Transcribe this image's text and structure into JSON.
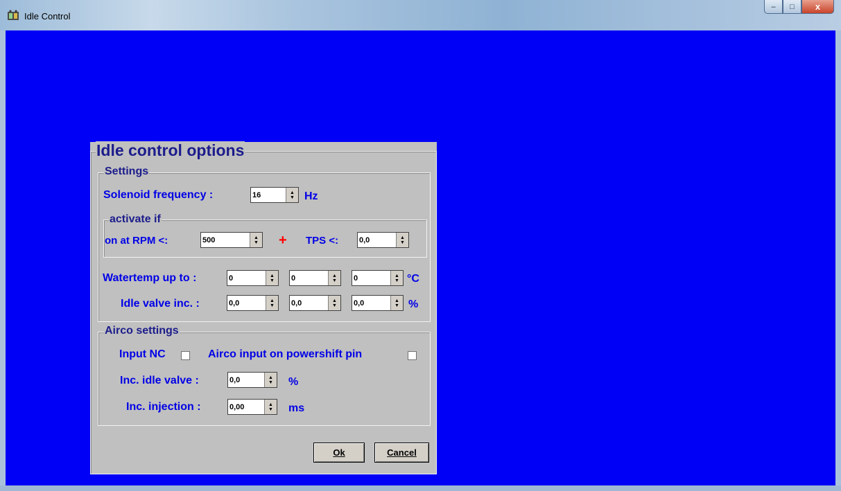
{
  "window": {
    "title": "Idle Control",
    "minimize": "–",
    "maximize": "□",
    "close": "x"
  },
  "dialog": {
    "title": "Idle control options",
    "settings": {
      "legend": "Settings",
      "solenoid_label": "Solenoid frequency :",
      "solenoid_value": "16",
      "solenoid_unit": "Hz",
      "activate": {
        "legend": "activate if",
        "rpm_label": "on at RPM  <:",
        "rpm_value": "500",
        "plus": "+",
        "tps_label": "TPS <:",
        "tps_value": "0,0"
      },
      "watertemp_label": "Watertemp up to :",
      "watertemp_values": [
        "0",
        "0",
        "0"
      ],
      "watertemp_unit": "°C",
      "idle_valve_label": "Idle valve inc. :",
      "idle_valve_values": [
        "0,0",
        "0,0",
        "0,0"
      ],
      "idle_valve_unit": "%"
    },
    "airco": {
      "legend": "Airco settings",
      "input_nc_label": "Input NC",
      "powershift_label": "Airco input on powershift pin",
      "inc_idle_label": "Inc. idle valve :",
      "inc_idle_value": "0,0",
      "inc_idle_unit": "%",
      "inc_injection_label": "Inc. injection :",
      "inc_injection_value": "0,00",
      "inc_injection_unit": "ms"
    },
    "ok_label": "Ok",
    "cancel_label": "Cancel"
  },
  "colors": {
    "client_bg": "#0000f6",
    "label": "#0000e6",
    "legend": "#1c1c8c",
    "plus": "#ff0000"
  }
}
